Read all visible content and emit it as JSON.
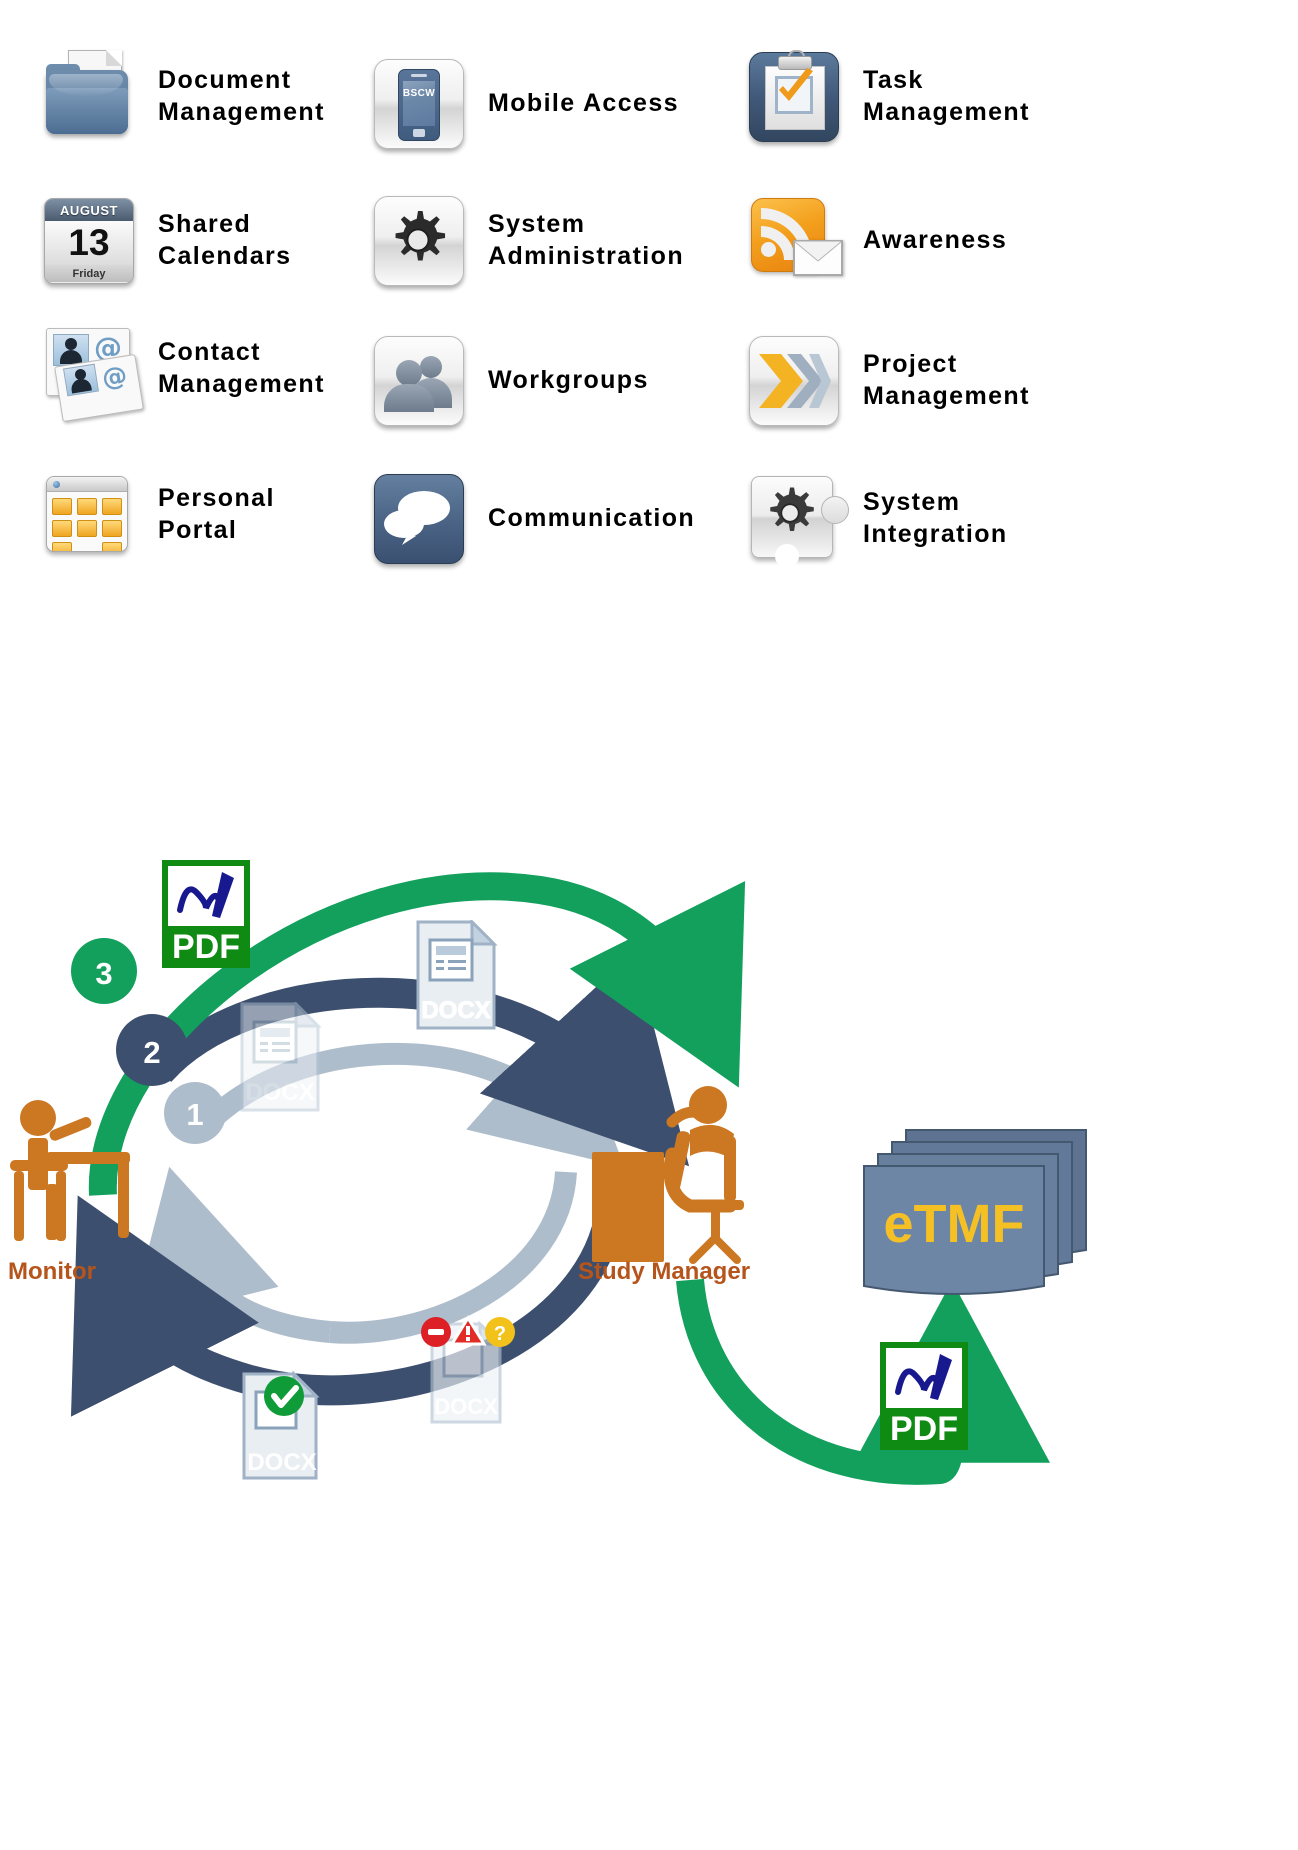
{
  "features": {
    "grid": [
      {
        "id": "document-management",
        "label": "Document\nManagement",
        "icon": "folder-document-icon",
        "col": 0,
        "row": 0
      },
      {
        "id": "mobile-access",
        "label": "Mobile Access",
        "icon": "smartphone-icon",
        "col": 1,
        "row": 0,
        "icon_text": "BSCW"
      },
      {
        "id": "task-management",
        "label": "Task\nManagement",
        "icon": "clipboard-check-icon",
        "col": 2,
        "row": 0
      },
      {
        "id": "shared-calendars",
        "label": "Shared\nCalendars",
        "icon": "calendar-icon",
        "col": 0,
        "row": 1,
        "calendar": {
          "month": "AUGUST",
          "day": "13",
          "weekday": "Friday"
        }
      },
      {
        "id": "system-administration",
        "label": "System\nAdministration",
        "icon": "gear-icon",
        "col": 1,
        "row": 1
      },
      {
        "id": "awareness",
        "label": "Awareness",
        "icon": "rss-envelope-icon",
        "col": 2,
        "row": 1
      },
      {
        "id": "contact-management",
        "label": "Contact\nManagement",
        "icon": "contact-cards-icon",
        "col": 0,
        "row": 2
      },
      {
        "id": "workgroups",
        "label": "Workgroups",
        "icon": "users-group-icon",
        "col": 1,
        "row": 2
      },
      {
        "id": "project-management",
        "label": "Project\nManagement",
        "icon": "chevrons-icon",
        "col": 2,
        "row": 2
      },
      {
        "id": "personal-portal",
        "label": "Personal\nPortal",
        "icon": "portal-layout-icon",
        "col": 0,
        "row": 3
      },
      {
        "id": "communication",
        "label": "Communication",
        "icon": "speech-bubbles-icon",
        "col": 1,
        "row": 3
      },
      {
        "id": "system-integration",
        "label": "System\nIntegration",
        "icon": "puzzle-gear-icon",
        "col": 2,
        "row": 3
      }
    ]
  },
  "cycle": {
    "roles": {
      "monitor": {
        "label": "Monitor",
        "icon": "person-at-desk-icon"
      },
      "study_manager": {
        "label": "Study Manager",
        "icon": "person-at-desk-icon"
      }
    },
    "archive": {
      "label": "eTMF",
      "icon": "document-stack-icon"
    },
    "steps": [
      {
        "number": "1",
        "color": "#aebdcc",
        "document": "DOCX",
        "doc_state": "draft"
      },
      {
        "number": "2",
        "color": "#3c4f6e",
        "document": "DOCX",
        "doc_state": "reviewed"
      },
      {
        "number": "3",
        "color": "#12a05c",
        "document": "PDF",
        "doc_state": "signed"
      }
    ],
    "documents": [
      {
        "id": "doc-draft-docx",
        "type": "DOCX",
        "badge": "none"
      },
      {
        "id": "doc-review-docx",
        "type": "DOCX",
        "badge": "none"
      },
      {
        "id": "doc-rejected-docx",
        "type": "DOCX",
        "badge": "error-warning-question"
      },
      {
        "id": "doc-approved-docx",
        "type": "DOCX",
        "badge": "check"
      },
      {
        "id": "doc-signed-pdf-top",
        "type": "PDF",
        "badge": "signature"
      },
      {
        "id": "doc-signed-pdf-bottom",
        "type": "PDF",
        "badge": "signature"
      }
    ],
    "colors": {
      "light_blue": "#aebdcc",
      "dark_blue": "#3c4f6e",
      "green": "#12a05c",
      "orange": "#cc7722",
      "label_brown": "#b5541b",
      "etmf_slate": "#697f9e",
      "etmf_gold": "#f5c024"
    }
  }
}
